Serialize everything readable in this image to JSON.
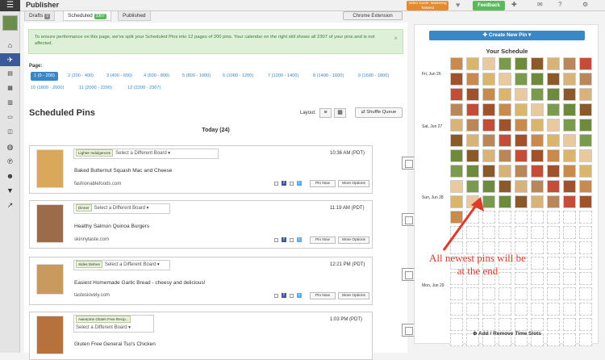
{
  "header": {
    "title": "Publisher",
    "video_guide": "Video Guide: Mastering Tailwind",
    "feedback": "Feedback",
    "chrome_extension": "Chrome Extension"
  },
  "tabs": [
    {
      "label": "Drafts",
      "badge": "0"
    },
    {
      "label": "Scheduled",
      "badge": "2307"
    },
    {
      "label": "Published",
      "badge": ""
    }
  ],
  "notice": {
    "text": "To ensure performance on this page, we've split your Scheduled Pins into 12 pages of 200 pins. Your calendar on the right still shows all 2307 of your pins and is not affected.",
    "close": "×"
  },
  "pagination": {
    "label": "Page:",
    "pages": [
      "1 (0 - 200)",
      "2 (200 - 400)",
      "3 (400 - 600)",
      "4 (600 - 800)",
      "5 (800 - 1000)",
      "6 (1000 - 1200)",
      "7 (1200 - 1400)",
      "8 (1400 - 1600)",
      "9 (1600 - 1800)",
      "10 (1800 - 2000)",
      "11 (2000 - 2200)",
      "12 (2200 - 2307)"
    ]
  },
  "scheduled": {
    "title": "Scheduled Pins",
    "layout_label": "Layout:",
    "shuffle": "Shuffle Queue",
    "today": "Today (24)"
  },
  "pins": [
    {
      "board": "Lighter Indulgences",
      "select": "Select a Different Board",
      "time": "10:36 AM (PDT)",
      "desc": "Baked Butternut Squash Mac and Cheese",
      "source": "fashionablefoods.com",
      "img_color": "#d9a85a"
    },
    {
      "board": "Dinner",
      "select": "Select a Different Board",
      "time": "11:19 AM (PDT)",
      "desc": "Healthy Salmon Quinoa Burgers",
      "source": "skinnytaste.com",
      "img_color": "#9c6b4a"
    },
    {
      "board": "Sides Dishes",
      "select": "Select a Different Board",
      "time": "12:21 PM (PDT)",
      "desc": "Easiest Homemade Garlic Bread - cheesy and delicious!",
      "source": "tastesiovely.com",
      "img_color": "#c99a5e"
    },
    {
      "board": "Awesome Gluten Free Recip...",
      "select": "Select a Different Board",
      "time": "1:03 PM (PDT)",
      "desc": "Gluten Free General Tso's Chicken",
      "source": "",
      "img_color": "#b7713d"
    }
  ],
  "pin_actions": {
    "pin_now": "Pin Now",
    "more_options": "More Options"
  },
  "schedule": {
    "create": "Create New Pin",
    "title": "Your Schedule",
    "days": [
      "Fri, Jun 26",
      "Sat, Jun 27",
      "Sun, Jun 28",
      "Mon, Jun 29"
    ],
    "add_remove": "Add / Remove Time Slots"
  },
  "annotation": "All newest pins will be at the end",
  "colors": {
    "accent": "#3a87c8",
    "success": "#5cb85c",
    "annotation": "#e03a2a"
  }
}
